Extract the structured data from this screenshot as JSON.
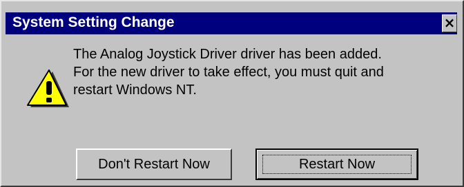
{
  "dialog": {
    "title": "System Setting Change",
    "close_glyph": "✕",
    "icon": "warning-icon",
    "message_lines": [
      "The Analog Joystick Driver driver has been added.",
      "For the new driver to take effect, you must quit and",
      "restart Windows NT."
    ],
    "buttons": {
      "dont_restart_label": "Don't Restart Now",
      "restart_label": "Restart Now"
    }
  },
  "colors": {
    "titlebar": "#00007f",
    "face": "#c3c3c3",
    "warning_fill": "#ffff00"
  }
}
